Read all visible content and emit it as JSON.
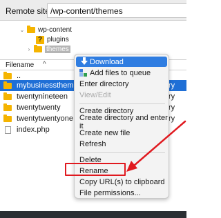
{
  "remote_site": {
    "label": "Remote site:",
    "path": "/wp-content/themes"
  },
  "tree": [
    {
      "label": "wp-content",
      "icon": "folder-icon"
    },
    {
      "label": "plugins",
      "icon": "folder-question-icon"
    },
    {
      "label": "themes",
      "icon": "folder-icon",
      "selected": true
    }
  ],
  "list": {
    "header": "Filename",
    "sort_indicator": "^",
    "rows": [
      {
        "name": "..",
        "icon": "folder-icon",
        "tail": ""
      },
      {
        "name": "mybusinesstheme",
        "icon": "folder-icon",
        "tail": "ry",
        "selected": true
      },
      {
        "name": "twentynineteen",
        "icon": "folder-icon",
        "tail": "ry"
      },
      {
        "name": "twentytwenty",
        "icon": "folder-icon",
        "tail": "ry"
      },
      {
        "name": "twentytwentyone",
        "icon": "folder-icon",
        "tail": "ry"
      },
      {
        "name": "index.php",
        "icon": "file-icon",
        "tail": ""
      }
    ]
  },
  "context_menu": {
    "items": [
      {
        "label": "Download",
        "icon": "download-icon",
        "highlighted": true
      },
      {
        "label": "Add files to queue",
        "icon": "add-to-queue-icon"
      },
      {
        "label": "Enter directory"
      },
      {
        "label": "View/Edit",
        "disabled": true
      },
      {
        "label": "Create directory"
      },
      {
        "label": "Create directory and enter it"
      },
      {
        "label": "Create new file"
      },
      {
        "label": "Refresh"
      },
      {
        "label": "Delete"
      },
      {
        "label": "Rename"
      },
      {
        "label": "Copy URL(s) to clipboard"
      },
      {
        "label": "File permissions..."
      }
    ]
  },
  "colors": {
    "selection": "#1f6fd6",
    "menu_highlight": "#2f7de1",
    "annotation": "#e0191f",
    "folder": "#f5b400"
  }
}
